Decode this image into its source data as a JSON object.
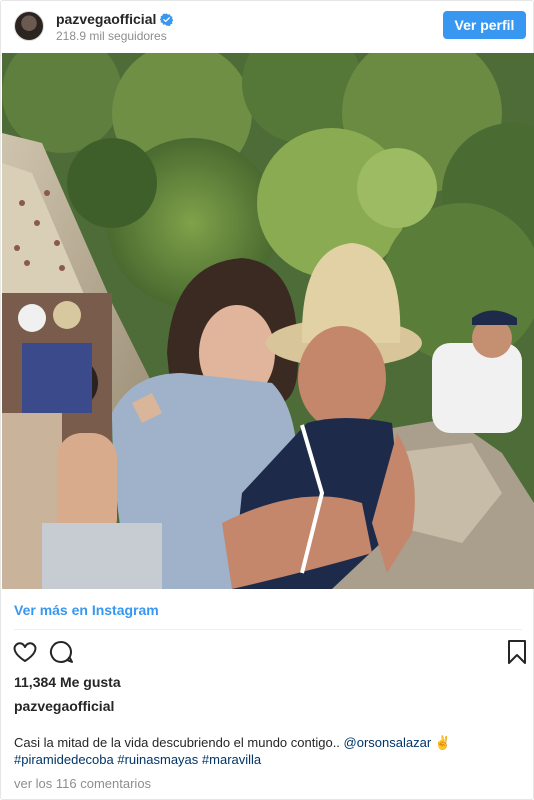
{
  "header": {
    "username": "pazvegaofficial",
    "followers": "218.9 mil seguidores",
    "view_profile": "Ver perfil",
    "avatar_icon": "profile-avatar",
    "verified_icon": "verified-badge-icon"
  },
  "photo": {
    "icon": "post-photo"
  },
  "view_more": "Ver más en Instagram",
  "actions": {
    "like_icon": "heart-icon",
    "comment_icon": "comment-icon",
    "save_icon": "bookmark-icon"
  },
  "likes": "11,384 Me gusta",
  "owner": "pazvegaofficial",
  "caption": {
    "text": "Casi la mitad de la vida descubriendo el mundo contigo.. ",
    "mention": "@orsonsalazar",
    "emoji": "✌",
    "hashtags": [
      "#piramidedecoba",
      "#ruinasmayas",
      "#maravilla"
    ]
  },
  "comments_link": "ver los 116 comentarios",
  "colors": {
    "accent": "#3897f0",
    "link_dark": "#003569",
    "muted": "#8e8e8e",
    "text": "#262626"
  }
}
